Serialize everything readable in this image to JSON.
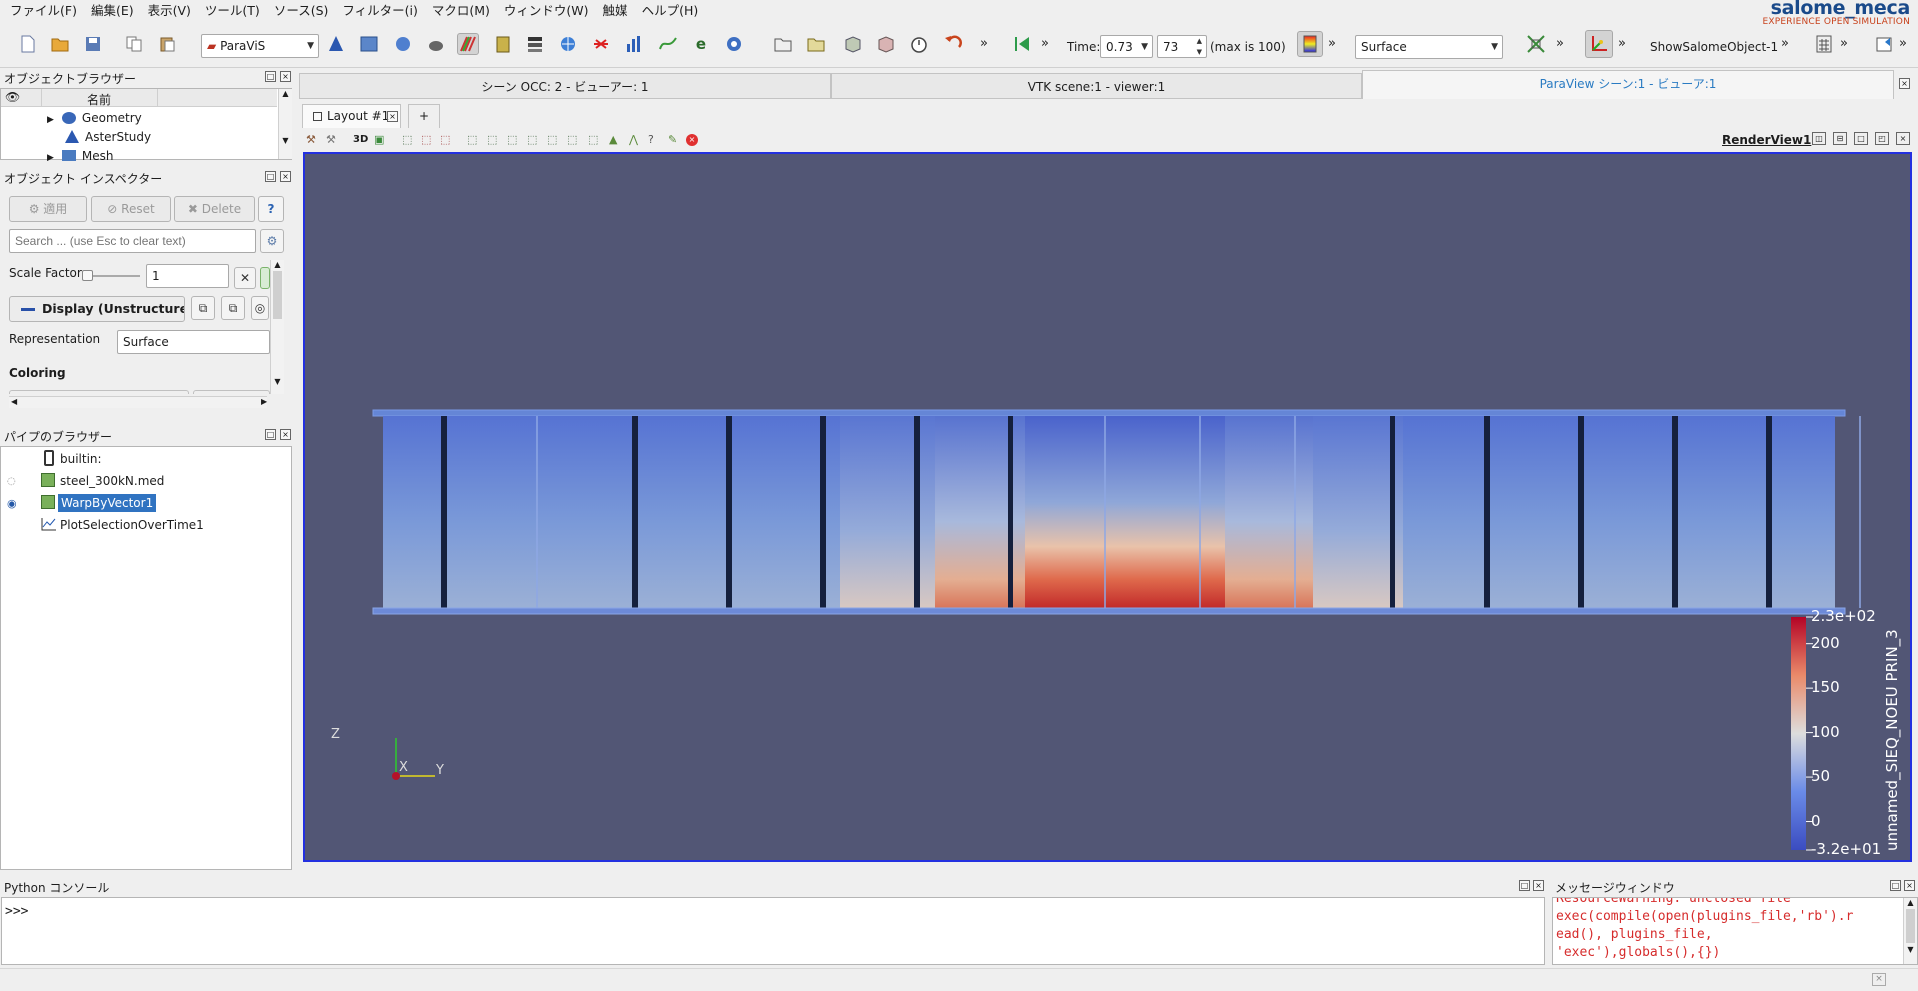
{
  "menubar": {
    "items": [
      "ファイル(F)",
      "編集(E)",
      "表示(V)",
      "ツール(T)",
      "ソース(S)",
      "フィルター(i)",
      "マクロ(M)",
      "ウィンドウ(W)",
      "触媒",
      "ヘルプ(H)"
    ]
  },
  "brand": {
    "name": "salome_meca",
    "tagline": "EXPERIENCE OPEN SIMULATION"
  },
  "toolbar": {
    "module": "ParaViS",
    "time_label": "Time:",
    "time_value": "0.73",
    "timestep_value": "73",
    "max_label": "(max is 100)",
    "representation": "Surface",
    "macro_label": "ShowSalomeObject-1"
  },
  "object_browser": {
    "title": "オブジェクトブラウザー",
    "column_name": "名前",
    "items": [
      "Geometry",
      "AsterStudy",
      "Mesh"
    ]
  },
  "inspector": {
    "title": "オブジェクト インスペクター",
    "apply": "適用",
    "reset": "Reset",
    "delete": "Delete",
    "help": "?",
    "search_placeholder": "Search ... (use Esc to clear text)",
    "scale_factor_label": "Scale Factor",
    "scale_factor_value": "1",
    "display_label": "Display (UnstructuredG",
    "representation_label": "Representation",
    "representation_value": "Surface",
    "coloring_label": "Coloring"
  },
  "pipeline": {
    "title": "パイプのブラウザー",
    "items": [
      "builtin:",
      "steel_300kN.med",
      "WarpByVector1",
      "PlotSelectionOverTime1"
    ],
    "selected": "WarpByVector1"
  },
  "view_tabs": {
    "tabs": [
      "シーン OCC: 2 - ビューアー: 1",
      "VTK scene:1 - viewer:1",
      "ParaView シーン:1 - ビューア:1"
    ],
    "active": "ParaView シーン:1 - ビューア:1"
  },
  "layout": {
    "tab_label": "Layout #1",
    "add_label": "+",
    "render_view_label": "RenderView1",
    "view_mode_3d": "3D"
  },
  "scalar_bar": {
    "title": "unnamed_SIEQ_NOEU PRIN_3",
    "labels": [
      "2.3e+02",
      "200",
      "150",
      "100",
      "50",
      "0",
      "-3.2e+01"
    ],
    "range": [
      -32,
      230
    ],
    "colors": {
      "low": "#3b4cc0",
      "mid": "#dddddd",
      "high": "#b40426"
    }
  },
  "axes": {
    "z": "Z",
    "y": "Y",
    "x": "X"
  },
  "colors": {
    "viewport_bg": "#525675",
    "highlight": "#3073c1",
    "tab_active_text": "#2a7bc2"
  },
  "python": {
    "title": "Python コンソール",
    "prompt": ">>>"
  },
  "messages": {
    "title": "メッセージウィンドウ",
    "lines": [
      "ResourceWarning: unclosed file",
      "exec(compile(open(plugins_file,'rb').r",
      "ead(), plugins_file,",
      "'exec'),globals(),{})"
    ]
  }
}
